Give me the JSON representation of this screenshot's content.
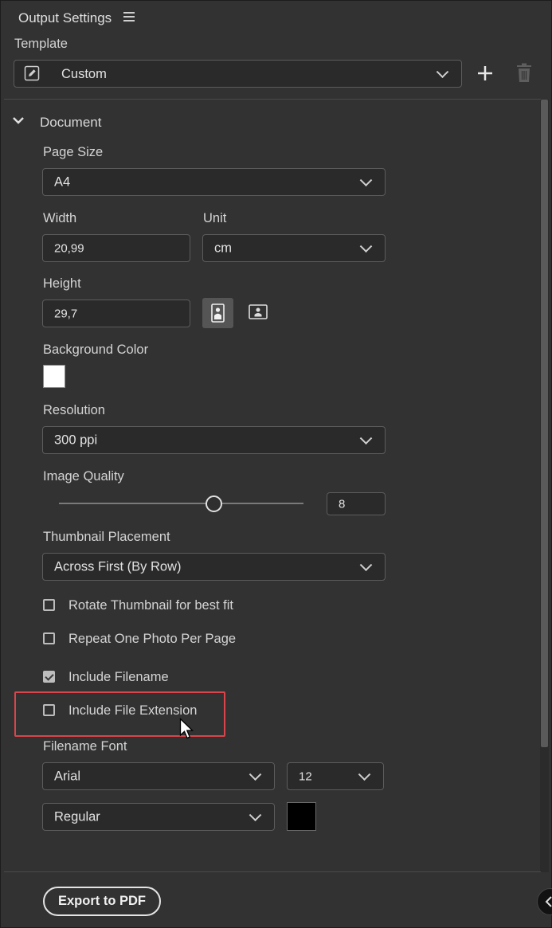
{
  "panel": {
    "title": "Output Settings"
  },
  "template": {
    "label": "Template",
    "selected": "Custom"
  },
  "document": {
    "section_label": "Document",
    "page_size": {
      "label": "Page Size",
      "value": "A4"
    },
    "width": {
      "label": "Width",
      "value": "20,99"
    },
    "unit": {
      "label": "Unit",
      "value": "cm"
    },
    "height": {
      "label": "Height",
      "value": "29,7"
    },
    "orientation": {
      "selected": "portrait"
    },
    "background_color": {
      "label": "Background Color",
      "color": "#ffffff"
    },
    "resolution": {
      "label": "Resolution",
      "value": "300 ppi"
    },
    "image_quality": {
      "label": "Image Quality",
      "value": "8"
    },
    "thumbnail_placement": {
      "label": "Thumbnail Placement",
      "value": "Across First (By Row)"
    },
    "options": [
      {
        "label": "Rotate Thumbnail for best fit",
        "checked": false
      },
      {
        "label": "Repeat One Photo Per Page",
        "checked": false
      },
      {
        "label": "Include Filename",
        "checked": true
      },
      {
        "label": "Include File Extension",
        "checked": false
      }
    ],
    "filename_font": {
      "label": "Filename Font",
      "family": "Arial",
      "size": "12",
      "style": "Regular",
      "color": "#000000"
    }
  },
  "footer": {
    "export_label": "Export to PDF"
  },
  "colors": {
    "panel_bg": "#323232",
    "highlight": "#d8454a"
  }
}
